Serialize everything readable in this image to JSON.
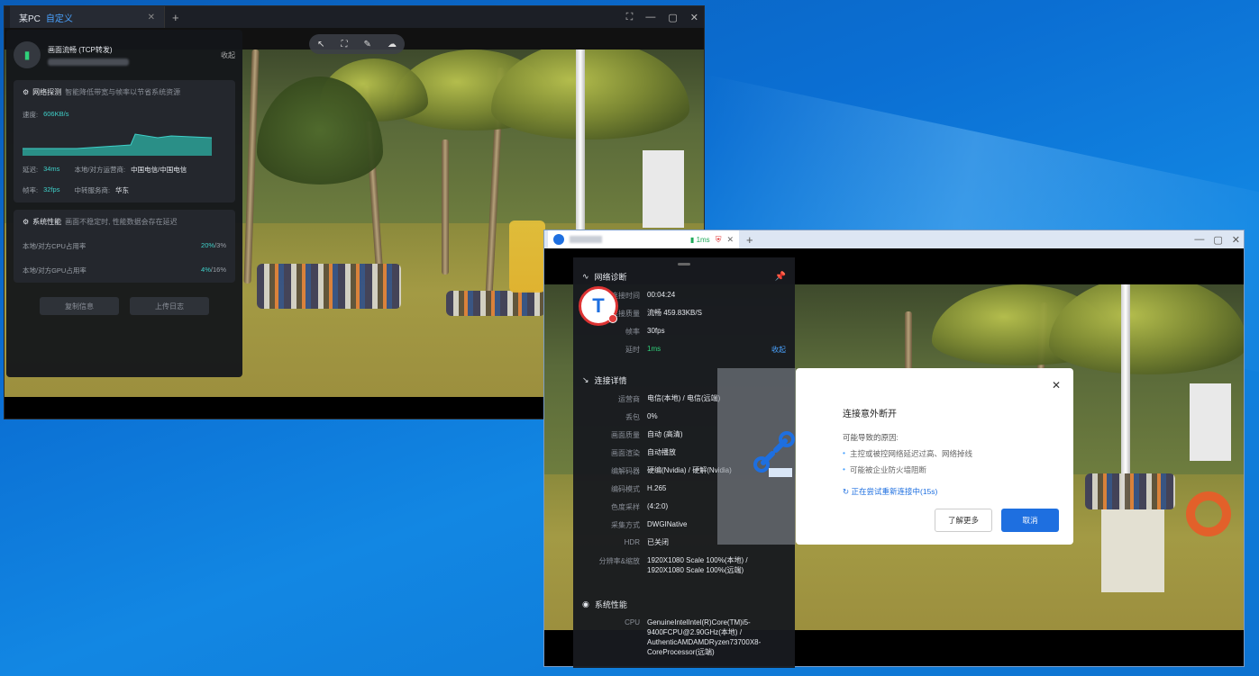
{
  "window1": {
    "tab_title": "某PC",
    "tab_badge": "自定义",
    "panel": {
      "quality": "画面流畅 (TCP转发)",
      "collapse": "收起",
      "network": {
        "title": "网络探测",
        "subtitle": "智能降低带宽与帧率以节省系统资源",
        "speed_label": "速度:",
        "speed_value": "606KB/s",
        "latency_label": "延迟:",
        "latency_value": "34ms",
        "carrier_label": "本地/对方运营商:",
        "carrier_value": "中国电信/中国电信",
        "fps_label": "帧率:",
        "fps_value": "32fps",
        "relay_label": "中转服务商:",
        "relay_value": "华东"
      },
      "perf": {
        "title": "系统性能",
        "subtitle": "画面不稳定时, 性能数据会存在延迟",
        "cpu_label": "本地/对方CPU占用率",
        "cpu_local": "20%",
        "cpu_remote": "/3%",
        "gpu_label": "本地/对方GPU占用率",
        "gpu_local": "4%",
        "gpu_remote": "/16%"
      },
      "copy_button": "复制信息",
      "upload_button": "上传日志"
    }
  },
  "window2": {
    "tab_latency": "1ms",
    "diag": {
      "title": "网络诊断",
      "rows": [
        {
          "k": "连接时间",
          "v": "00:04:24"
        },
        {
          "k": "连接质量",
          "v": "流畅 459.83KB/S"
        },
        {
          "k": "帧率",
          "v": "30fps"
        },
        {
          "k": "延时",
          "v": "1ms"
        }
      ],
      "more": "收起",
      "details_title": "连接详情",
      "details": [
        {
          "k": "运营商",
          "v": "电信(本地) / 电信(远端)"
        },
        {
          "k": "丢包",
          "v": "0%"
        },
        {
          "k": "画面质量",
          "v": "自动 (高清)"
        },
        {
          "k": "画面渲染",
          "v": "自动播放"
        },
        {
          "k": "编解码器",
          "v": "硬编(Nvidia) / 硬解(Nvidia)"
        },
        {
          "k": "编码模式",
          "v": "H.265"
        },
        {
          "k": "色度采样",
          "v": "(4:2:0)"
        },
        {
          "k": "采集方式",
          "v": "DWGINative"
        },
        {
          "k": "HDR",
          "v": "已关闭"
        },
        {
          "k": "分辨率&缩放",
          "v": "1920X1080 Scale 100%(本地) / 1920X1080 Scale 100%(远端)"
        }
      ],
      "perf_title": "系统性能",
      "cpu_label": "CPU",
      "cpu_value": "GenuineIntelIntel(R)Core(TM)i5-9400FCPU@2.90GHz(本地) / AuthenticAMDAMDRyzen73700X8-CoreProcessor(远端)"
    },
    "dialog": {
      "title": "连接意外断开",
      "reason": "可能导致的原因:",
      "items": [
        "主控或被控网络延迟过高、网络掉线",
        "可能被企业防火墙阻断"
      ],
      "retry": "正在尝试重新连接中(15s)",
      "learn_more": "了解更多",
      "cancel": "取消"
    }
  },
  "colors": {
    "accent": "#1e6fe0",
    "good": "#2fd27a",
    "teal": "#3fd0c9"
  }
}
